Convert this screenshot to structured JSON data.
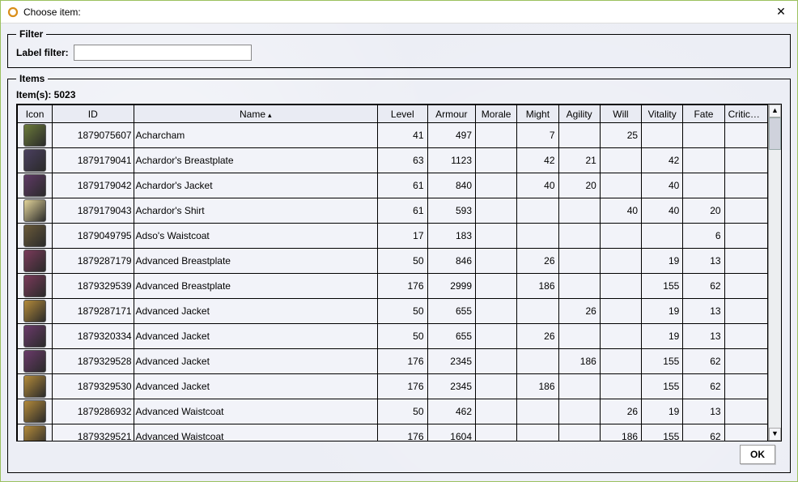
{
  "window": {
    "title": "Choose item:",
    "close_glyph": "✕"
  },
  "filter": {
    "legend": "Filter",
    "label": "Label filter:",
    "value": ""
  },
  "items": {
    "legend": "Items",
    "count_label": "Item(s): 5023"
  },
  "columns": {
    "icon": "Icon",
    "id": "ID",
    "name": "Name",
    "level": "Level",
    "armour": "Armour",
    "morale": "Morale",
    "might": "Might",
    "agility": "Agility",
    "will": "Will",
    "vitality": "Vitality",
    "fate": "Fate",
    "critical": "Critical ..."
  },
  "sort": {
    "column": "name",
    "direction": "asc",
    "glyph": "▴"
  },
  "rows": [
    {
      "icon_color": "#6b7a3a",
      "id": "1879075607",
      "name": "Acharcham",
      "level": "41",
      "armour": "497",
      "morale": "",
      "might": "7",
      "agility": "",
      "will": "25",
      "vitality": "",
      "fate": "",
      "critical": ""
    },
    {
      "icon_color": "#4a3f5f",
      "id": "1879179041",
      "name": "Achardor's Breastplate",
      "level": "63",
      "armour": "1123",
      "morale": "",
      "might": "42",
      "agility": "21",
      "will": "",
      "vitality": "42",
      "fate": "",
      "critical": ""
    },
    {
      "icon_color": "#5f3a66",
      "id": "1879179042",
      "name": "Achardor's Jacket",
      "level": "61",
      "armour": "840",
      "morale": "",
      "might": "40",
      "agility": "20",
      "will": "",
      "vitality": "40",
      "fate": "",
      "critical": ""
    },
    {
      "icon_color": "#e3d49a",
      "id": "1879179043",
      "name": "Achardor's Shirt",
      "level": "61",
      "armour": "593",
      "morale": "",
      "might": "",
      "agility": "",
      "will": "40",
      "vitality": "40",
      "fate": "20",
      "critical": ""
    },
    {
      "icon_color": "#6a5a3a",
      "id": "1879049795",
      "name": "Adso's Waistcoat",
      "level": "17",
      "armour": "183",
      "morale": "",
      "might": "",
      "agility": "",
      "will": "",
      "vitality": "",
      "fate": "6",
      "critical": ""
    },
    {
      "icon_color": "#7a3a5a",
      "id": "1879287179",
      "name": "Advanced Breastplate",
      "level": "50",
      "armour": "846",
      "morale": "",
      "might": "26",
      "agility": "",
      "will": "",
      "vitality": "19",
      "fate": "13",
      "critical": ""
    },
    {
      "icon_color": "#7a3a5a",
      "id": "1879329539",
      "name": "Advanced Breastplate",
      "level": "176",
      "armour": "2999",
      "morale": "",
      "might": "186",
      "agility": "",
      "will": "",
      "vitality": "155",
      "fate": "62",
      "critical": ""
    },
    {
      "icon_color": "#b38a3a",
      "id": "1879287171",
      "name": "Advanced Jacket",
      "level": "50",
      "armour": "655",
      "morale": "",
      "might": "",
      "agility": "26",
      "will": "",
      "vitality": "19",
      "fate": "13",
      "critical": ""
    },
    {
      "icon_color": "#6a3a6a",
      "id": "1879320334",
      "name": "Advanced Jacket",
      "level": "50",
      "armour": "655",
      "morale": "",
      "might": "26",
      "agility": "",
      "will": "",
      "vitality": "19",
      "fate": "13",
      "critical": ""
    },
    {
      "icon_color": "#6a3a6a",
      "id": "1879329528",
      "name": "Advanced Jacket",
      "level": "176",
      "armour": "2345",
      "morale": "",
      "might": "",
      "agility": "186",
      "will": "",
      "vitality": "155",
      "fate": "62",
      "critical": ""
    },
    {
      "icon_color": "#b38a3a",
      "id": "1879329530",
      "name": "Advanced Jacket",
      "level": "176",
      "armour": "2345",
      "morale": "",
      "might": "186",
      "agility": "",
      "will": "",
      "vitality": "155",
      "fate": "62",
      "critical": ""
    },
    {
      "icon_color": "#b38a3a",
      "id": "1879286932",
      "name": "Advanced Waistcoat",
      "level": "50",
      "armour": "462",
      "morale": "",
      "might": "",
      "agility": "",
      "will": "26",
      "vitality": "19",
      "fate": "13",
      "critical": ""
    },
    {
      "icon_color": "#b38a3a",
      "id": "1879329521",
      "name": "Advanced Waistcoat",
      "level": "176",
      "armour": "1604",
      "morale": "",
      "might": "",
      "agility": "",
      "will": "186",
      "vitality": "155",
      "fate": "62",
      "critical": ""
    }
  ],
  "footer": {
    "ok": "OK"
  },
  "scroll": {
    "up": "▲",
    "down": "▼"
  }
}
